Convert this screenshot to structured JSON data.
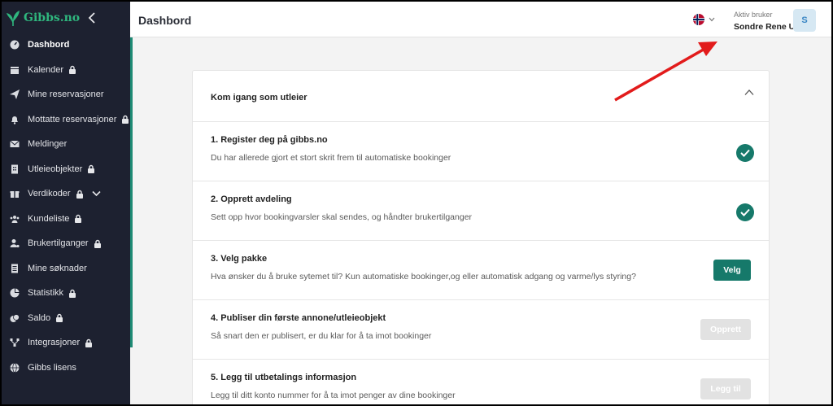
{
  "brand": {
    "name": "Gibbs.no"
  },
  "sidebar": {
    "items": [
      {
        "label": "Dashbord",
        "icon": "dashboard-icon",
        "locked": false,
        "active": true
      },
      {
        "label": "Kalender",
        "icon": "calendar-icon",
        "locked": true
      },
      {
        "label": "Mine reservasjoner",
        "icon": "paper-plane-icon",
        "locked": false
      },
      {
        "label": "Mottatte reservasjoner",
        "icon": "bell-icon",
        "locked": true
      },
      {
        "label": "Meldinger",
        "icon": "envelope-icon",
        "locked": false
      },
      {
        "label": "Utleieobjekter",
        "icon": "building-icon",
        "locked": true
      },
      {
        "label": "Verdikoder",
        "icon": "gift-icon",
        "locked": true,
        "expandable": true
      },
      {
        "label": "Kundeliste",
        "icon": "users-icon",
        "locked": true
      },
      {
        "label": "Brukertilganger",
        "icon": "user-cog-icon",
        "locked": true
      },
      {
        "label": "Mine søknader",
        "icon": "document-icon",
        "locked": false
      },
      {
        "label": "Statistikk",
        "icon": "pie-chart-icon",
        "locked": true
      },
      {
        "label": "Saldo",
        "icon": "coins-icon",
        "locked": true
      },
      {
        "label": "Integrasjoner",
        "icon": "network-icon",
        "locked": true
      },
      {
        "label": "Gibbs lisens",
        "icon": "globe-icon",
        "locked": false
      }
    ]
  },
  "header": {
    "title": "Dashbord",
    "language_icon": "norway-flag-icon",
    "user_caption": "Aktiv bruker",
    "user_name": "Sondre Rene Ulr",
    "avatar_initial": "S"
  },
  "onboarding": {
    "title": "Kom igang som utleier",
    "steps": [
      {
        "title": "1. Register deg på gibbs.no",
        "description": "Du har allerede gjort et stort skrit frem til automatiske bookinger",
        "status": "done"
      },
      {
        "title": "2. Opprett avdeling",
        "description": "Sett opp hvor bookingvarsler skal sendes, og håndter brukertilganger",
        "status": "done"
      },
      {
        "title": "3. Velg pakke",
        "description": "Hva ønsker du å bruke sytemet til? Kun automatiske bookinger,og eller automatisk adgang og varme/lys styring?",
        "status": "action",
        "button": "Velg"
      },
      {
        "title": "4. Publiser din første annone/utleieobjekt",
        "description": "Så snart den er publisert, er du klar for å ta imot bookinger",
        "status": "disabled",
        "button": "Opprett"
      },
      {
        "title": "5. Legg til utbetalings informasjon",
        "description": "Legg til ditt konto nummer for å ta imot penger av dine bookinger",
        "status": "disabled",
        "button": "Legg til"
      }
    ]
  },
  "colors": {
    "sidebar_bg": "#1d2130",
    "accent": "#16796a",
    "brand": "#2fb67e",
    "annotation_arrow": "#e21b1b"
  }
}
